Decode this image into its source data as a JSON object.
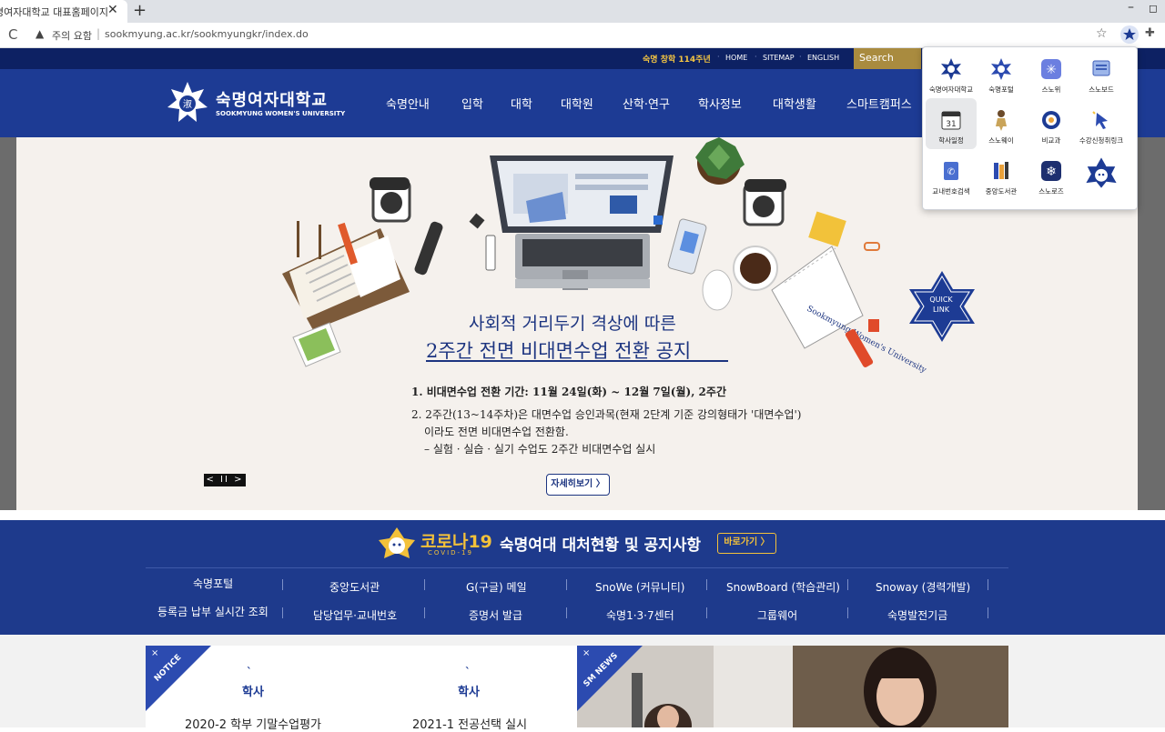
{
  "browser": {
    "tab_title": "명여자대학교 대표홈페이지",
    "tab_close": "✕",
    "new_tab": "+",
    "win_min": "–",
    "win_max": "◻",
    "reload": "C",
    "warning_icon": "▲",
    "warning_text": "주의 요함",
    "separator": "|",
    "url": "sookmyung.ac.kr/sookmyungkr/index.do",
    "bookmark_icon": "☆",
    "extensions_icon": "✚"
  },
  "top_strip": {
    "anniversary": "숙명 창학 114주년",
    "links": [
      "HOME",
      "SITEMAP",
      "ENGLISH"
    ],
    "search_label": "Search"
  },
  "header": {
    "logo_ko": "숙명여자대학교",
    "logo_en": "SOOKMYUNG WOMEN'S UNIVERSITY",
    "nav": [
      "숙명안내",
      "입학",
      "대학",
      "대학원",
      "산학·연구",
      "학사정보",
      "대학생활",
      "스마트캠퍼스"
    ]
  },
  "hero": {
    "title_line1": "사회적 거리두기 격상에 따른",
    "title_line2": "2주간 전면 비대면수업 전환 공지",
    "line1": "1. 비대면수업 전환 기간: 11월 24일(화) ~ 12월 7일(월), 2주간",
    "line2": "2. 2주간(13~14주차)은 대면수업 승인과목(현재 2단계 기준 강의형태가 '대면수업')",
    "line3": "이라도 전면 비대면수업 전환함.",
    "line4": "– 실험 · 실습 · 실기 수업도 2주간 비대면수업 실시",
    "more_button": "자세히보기 〉",
    "slider_controls": "< II >",
    "quicklink_label": "QUICK LINK",
    "notebook_text": "Sookmyung Women's University"
  },
  "covid": {
    "title": "코로나19",
    "subtitle": "COVID-19",
    "main": "숙명여대 대처현황 및 공지사항",
    "button": "바로가기 〉",
    "row1": [
      "숙명포털",
      "중앙도서관",
      "G(구글) 메일",
      "SnoWe (커뮤니티)",
      "SnowBoard (학습관리)",
      "Snoway (경력개발)"
    ],
    "row2": [
      "등록금 납부 실시간 조회",
      "담당업무·교내번호",
      "증명서 발급",
      "숙명1·3·7센터",
      "그룹웨어",
      "숙명발전기금"
    ]
  },
  "cards": {
    "notice_label": "NOTICE",
    "close": "×",
    "card1_category": "학사",
    "card1_title": "2020-2 학부 기말수업평가",
    "card2_category": "학사",
    "card2_title": "2021-1 전공선택 실시",
    "news_label": "SM NEWS",
    "tick": "`"
  },
  "popup": {
    "items": [
      {
        "label": "숙명여자대학교",
        "icon": "star-emblem-icon"
      },
      {
        "label": "숙명포털",
        "icon": "star-emblem-icon"
      },
      {
        "label": "스노위",
        "icon": "snowflake-app-icon"
      },
      {
        "label": "스노보드",
        "icon": "board-app-icon"
      },
      {
        "label": "학사일정",
        "icon": "calendar-icon",
        "calendar_day": "31"
      },
      {
        "label": "스노웨이",
        "icon": "person-walking-icon"
      },
      {
        "label": "비교과",
        "icon": "target-icon"
      },
      {
        "label": "수강신청취링크",
        "icon": "cursor-click-icon"
      },
      {
        "label": "교내번호검색",
        "icon": "phone-book-icon"
      },
      {
        "label": "중앙도서관",
        "icon": "books-icon"
      },
      {
        "label": "스노로즈",
        "icon": "snowflake-dark-icon"
      },
      {
        "label": "",
        "icon": "mascot-icon"
      }
    ]
  },
  "colors": {
    "navy": "#0d2163",
    "header_blue": "#1d3b94",
    "gold": "#a98b3f",
    "yellow": "#f3c13a",
    "hero_bg": "#f5f1ed"
  }
}
